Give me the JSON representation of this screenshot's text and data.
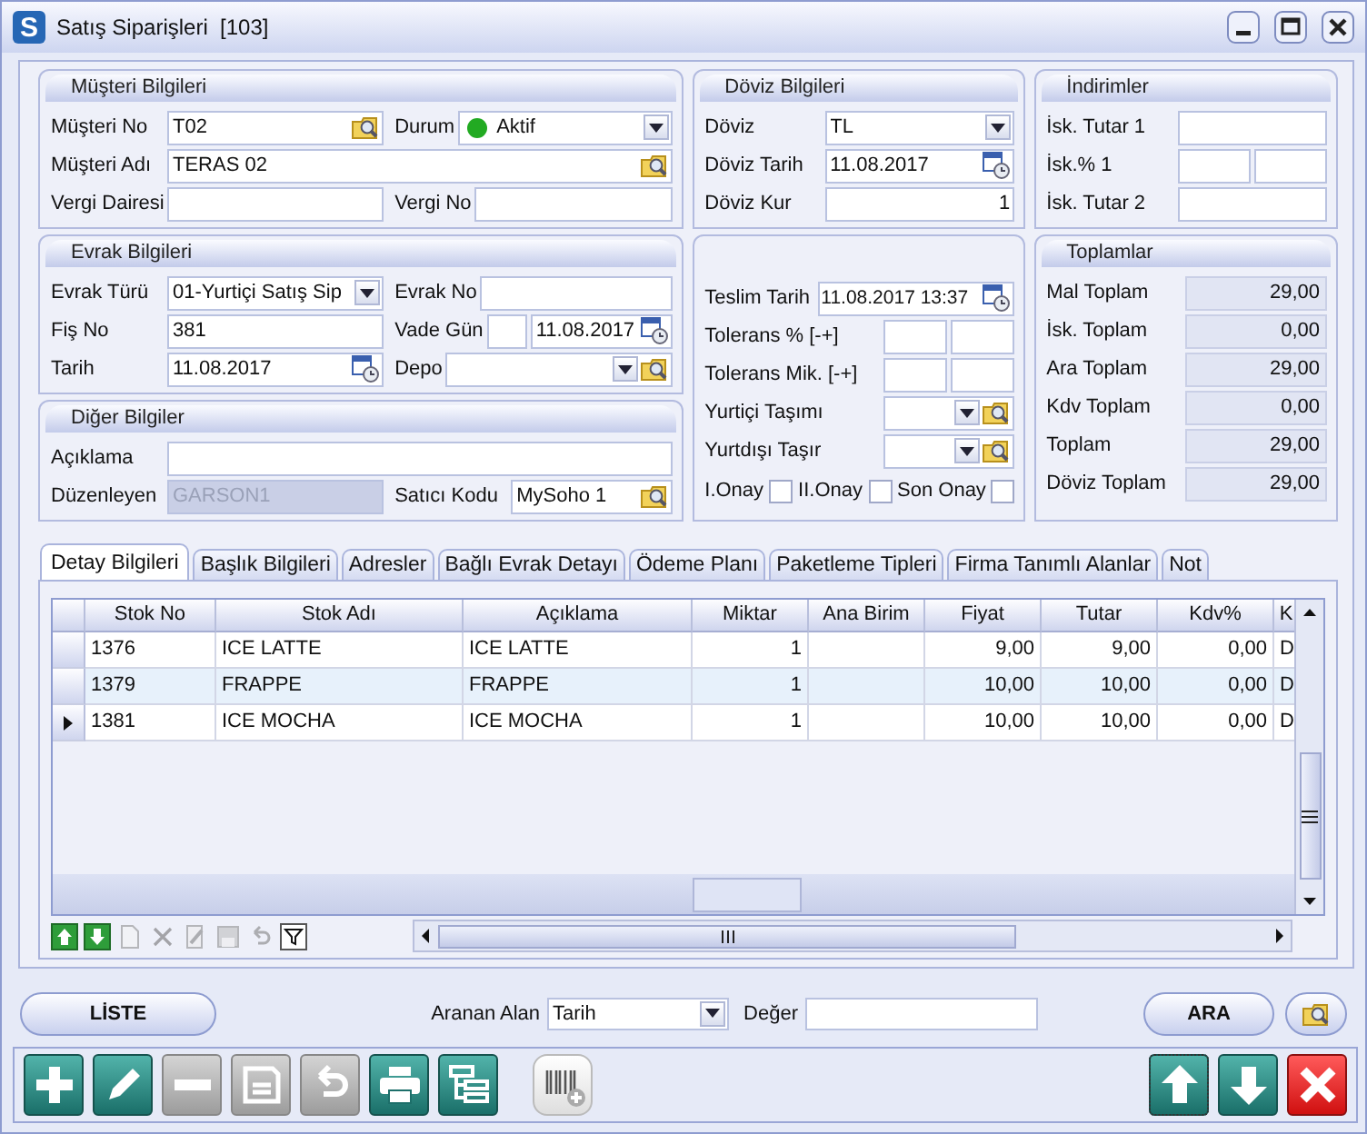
{
  "window": {
    "logo": "S",
    "title": "Satış Siparişleri  [103]",
    "controls": [
      {
        "kind": "minimize"
      },
      {
        "kind": "maximize"
      },
      {
        "kind": "close"
      }
    ]
  },
  "panel_columns": [
    {
      "sections": [
        {
          "title": "Müşteri Bilgileri",
          "rows": [
            {
              "cells": [
                {
                  "label": "Müşteri No",
                  "fields": [
                    {
                      "kind": "lookup",
                      "value": "T02"
                    }
                  ]
                },
                {
                  "label": "Durum",
                  "fields": [
                    {
                      "kind": "status",
                      "value": "Aktif",
                      "color": "#22aa22"
                    }
                  ]
                }
              ]
            },
            {
              "cells": [
                {
                  "label": "Müşteri Adı",
                  "fields": [
                    {
                      "kind": "lookup",
                      "value": "TERAS 02"
                    }
                  ]
                }
              ]
            },
            {
              "cells": [
                {
                  "label": "Vergi Dairesi",
                  "fields": [
                    {
                      "kind": "text"
                    }
                  ]
                },
                {
                  "label": "Vergi No",
                  "fields": [
                    {
                      "kind": "text"
                    }
                  ]
                }
              ]
            }
          ]
        },
        {
          "title": "Evrak Bilgileri",
          "rows": [
            {
              "cells": [
                {
                  "label": "Evrak Türü",
                  "fields": [
                    {
                      "kind": "combo",
                      "value": "01-Yurtiçi Satış Sip"
                    }
                  ]
                },
                {
                  "label": "Evrak No",
                  "fields": [
                    {
                      "kind": "text"
                    }
                  ]
                }
              ]
            },
            {
              "cells": [
                {
                  "label": "Fiş No",
                  "fields": [
                    {
                      "kind": "text",
                      "value": "381"
                    }
                  ]
                },
                {
                  "label": "Vade Gün",
                  "fields": [
                    {
                      "kind": "box"
                    },
                    {
                      "kind": "date",
                      "value": "11.08.2017"
                    }
                  ]
                }
              ]
            },
            {
              "cells": [
                {
                  "label": "Tarih",
                  "fields": [
                    {
                      "kind": "date",
                      "value": "11.08.2017"
                    }
                  ]
                },
                {
                  "label": "Depo",
                  "fields": [
                    {
                      "kind": "combo-lookup"
                    }
                  ]
                }
              ]
            }
          ]
        },
        {
          "title": "Diğer Bilgiler",
          "rows": [
            {
              "cells": [
                {
                  "label": "Açıklama",
                  "fields": [
                    {
                      "kind": "text"
                    }
                  ]
                }
              ]
            },
            {
              "cells": [
                {
                  "label": "Düzenleyen",
                  "fields": [
                    {
                      "kind": "readonly",
                      "value": "GARSON1",
                      "disabled": true
                    }
                  ]
                },
                {
                  "label": "Satıcı Kodu",
                  "fields": [
                    {
                      "kind": "lookup",
                      "value": "MySoho 1"
                    }
                  ]
                }
              ]
            }
          ]
        }
      ]
    },
    {
      "sections": [
        {
          "title": "Döviz Bilgileri",
          "rows": [
            {
              "cells": [
                {
                  "label": "Döviz",
                  "fields": [
                    {
                      "kind": "combo",
                      "value": "TL"
                    }
                  ]
                }
              ]
            },
            {
              "cells": [
                {
                  "label": "Döviz Tarih",
                  "fields": [
                    {
                      "kind": "date",
                      "value": "11.08.2017"
                    }
                  ]
                }
              ]
            },
            {
              "cells": [
                {
                  "label": "Döviz Kur",
                  "fields": [
                    {
                      "kind": "number",
                      "value": "1"
                    }
                  ]
                }
              ]
            }
          ]
        },
        {
          "rows": [
            {
              "cells": [
                {
                  "label": "Teslim Tarih",
                  "fields": [
                    {
                      "kind": "date",
                      "value": "11.08.2017 13:37"
                    }
                  ]
                }
              ]
            },
            {
              "cells": [
                {
                  "label": "Tolerans % [-+]",
                  "fields": [
                    {
                      "kind": "box"
                    },
                    {
                      "kind": "box"
                    }
                  ]
                }
              ]
            },
            {
              "cells": [
                {
                  "label": "Tolerans Mik. [-+]",
                  "fields": [
                    {
                      "kind": "box"
                    },
                    {
                      "kind": "box"
                    }
                  ]
                }
              ]
            },
            {
              "cells": [
                {
                  "label": "Yurtiçi Taşımı",
                  "fields": [
                    {
                      "kind": "combo-lookup"
                    }
                  ]
                }
              ]
            },
            {
              "cells": [
                {
                  "label": "Yurtdışı Taşır",
                  "fields": [
                    {
                      "kind": "combo-lookup"
                    }
                  ]
                }
              ]
            },
            {
              "kind": "checks",
              "cells": [
                {
                  "label": "I.Onay",
                  "fields": [
                    {
                      "kind": "check",
                      "checked": false
                    }
                  ]
                },
                {
                  "label": "II.Onay",
                  "fields": [
                    {
                      "kind": "check",
                      "checked": false
                    }
                  ]
                },
                {
                  "label": "Son Onay",
                  "fields": [
                    {
                      "kind": "check",
                      "checked": false
                    }
                  ]
                }
              ]
            }
          ]
        }
      ]
    },
    {
      "sections": [
        {
          "title": "İndirimler",
          "rows": [
            {
              "cells": [
                {
                  "label": "İsk. Tutar 1",
                  "fields": [
                    {
                      "kind": "text"
                    }
                  ]
                }
              ]
            },
            {
              "cells": [
                {
                  "label": "İsk.% 1",
                  "fields": [
                    {
                      "kind": "box"
                    },
                    {
                      "kind": "box"
                    }
                  ]
                }
              ]
            },
            {
              "cells": [
                {
                  "label": "İsk. Tutar 2",
                  "fields": [
                    {
                      "kind": "text"
                    }
                  ]
                }
              ]
            }
          ]
        },
        {
          "title": "Toplamlar",
          "rows": [
            {
              "cells": [
                {
                  "label": "Mal Toplam",
                  "fields": [
                    {
                      "kind": "total",
                      "value": "29,00"
                    }
                  ]
                }
              ]
            },
            {
              "cells": [
                {
                  "label": "İsk. Toplam",
                  "fields": [
                    {
                      "kind": "total",
                      "value": "0,00"
                    }
                  ]
                }
              ]
            },
            {
              "cells": [
                {
                  "label": "Ara Toplam",
                  "fields": [
                    {
                      "kind": "total",
                      "value": "29,00"
                    }
                  ]
                }
              ]
            },
            {
              "cells": [
                {
                  "label": "Kdv Toplam",
                  "fields": [
                    {
                      "kind": "total",
                      "value": "0,00"
                    }
                  ]
                }
              ]
            },
            {
              "cells": [
                {
                  "label": "Toplam",
                  "fields": [
                    {
                      "kind": "total",
                      "value": "29,00"
                    }
                  ]
                }
              ]
            },
            {
              "cells": [
                {
                  "label": "Döviz Toplam",
                  "fields": [
                    {
                      "kind": "total",
                      "value": "29,00"
                    }
                  ]
                }
              ]
            }
          ]
        }
      ]
    }
  ],
  "tabs": [
    {
      "label": "Detay Bilgileri",
      "selected": true
    },
    {
      "label": "Başlık Bilgileri",
      "selected": false
    },
    {
      "label": "Adresler",
      "selected": false
    },
    {
      "label": "Bağlı Evrak Detayı",
      "selected": false
    },
    {
      "label": "Ödeme Planı",
      "selected": false
    },
    {
      "label": "Paketleme Tipleri",
      "selected": false
    },
    {
      "label": "Firma Tanımlı Alanlar",
      "selected": false
    },
    {
      "label": "Not",
      "selected": false
    }
  ],
  "table": {
    "columns": [
      {
        "label": "Stok No",
        "kind": "text"
      },
      {
        "label": "Stok Adı",
        "kind": "text"
      },
      {
        "label": "Açıklama",
        "kind": "text"
      },
      {
        "label": "Miktar",
        "kind": "number"
      },
      {
        "label": "Ana Birim",
        "kind": "text"
      },
      {
        "label": "Fiyat",
        "kind": "number"
      },
      {
        "label": "Tutar",
        "kind": "number"
      },
      {
        "label": "Kdv%",
        "kind": "number"
      },
      {
        "label": "K",
        "kind": "text"
      }
    ],
    "rows": [
      {
        "selected": false,
        "highlighted": false,
        "cells": [
          "1376",
          "ICE LATTE",
          "ICE LATTE",
          "1",
          null,
          "9,00",
          "9,00",
          "0,00",
          "D"
        ]
      },
      {
        "selected": false,
        "highlighted": true,
        "cells": [
          "1379",
          "FRAPPE",
          "FRAPPE",
          "1",
          null,
          "10,00",
          "10,00",
          "0,00",
          "D"
        ]
      },
      {
        "selected": true,
        "highlighted": false,
        "cells": [
          "1381",
          "ICE MOCHA",
          "ICE MOCHA",
          "1",
          null,
          "10,00",
          "10,00",
          "0,00",
          "D"
        ]
      }
    ]
  },
  "grid_tools": [
    {
      "kind": "move-up",
      "disabled": false
    },
    {
      "kind": "move-down",
      "disabled": false
    },
    {
      "kind": "new",
      "disabled": true
    },
    {
      "kind": "delete",
      "disabled": true
    },
    {
      "kind": "edit",
      "disabled": true
    },
    {
      "kind": "save",
      "disabled": true
    },
    {
      "kind": "undo",
      "disabled": true
    },
    {
      "kind": "filter",
      "disabled": false
    }
  ],
  "search": {
    "list_button": "LİSTE",
    "field_label": "Aranan Alan",
    "field_value": "Tarih",
    "value_label": "Değer",
    "search_button": "ARA"
  },
  "toolbar": [
    {
      "kind": "add",
      "disabled": false
    },
    {
      "kind": "edit",
      "disabled": false
    },
    {
      "kind": "remove",
      "disabled": true
    },
    {
      "kind": "save",
      "disabled": true
    },
    {
      "kind": "undo",
      "disabled": true
    },
    {
      "kind": "print",
      "disabled": false
    },
    {
      "kind": "tree",
      "disabled": false
    },
    {
      "kind": "barcode-add",
      "disabled": true
    }
  ],
  "nav_buttons": [
    {
      "kind": "up"
    },
    {
      "kind": "down"
    },
    {
      "kind": "close"
    }
  ]
}
